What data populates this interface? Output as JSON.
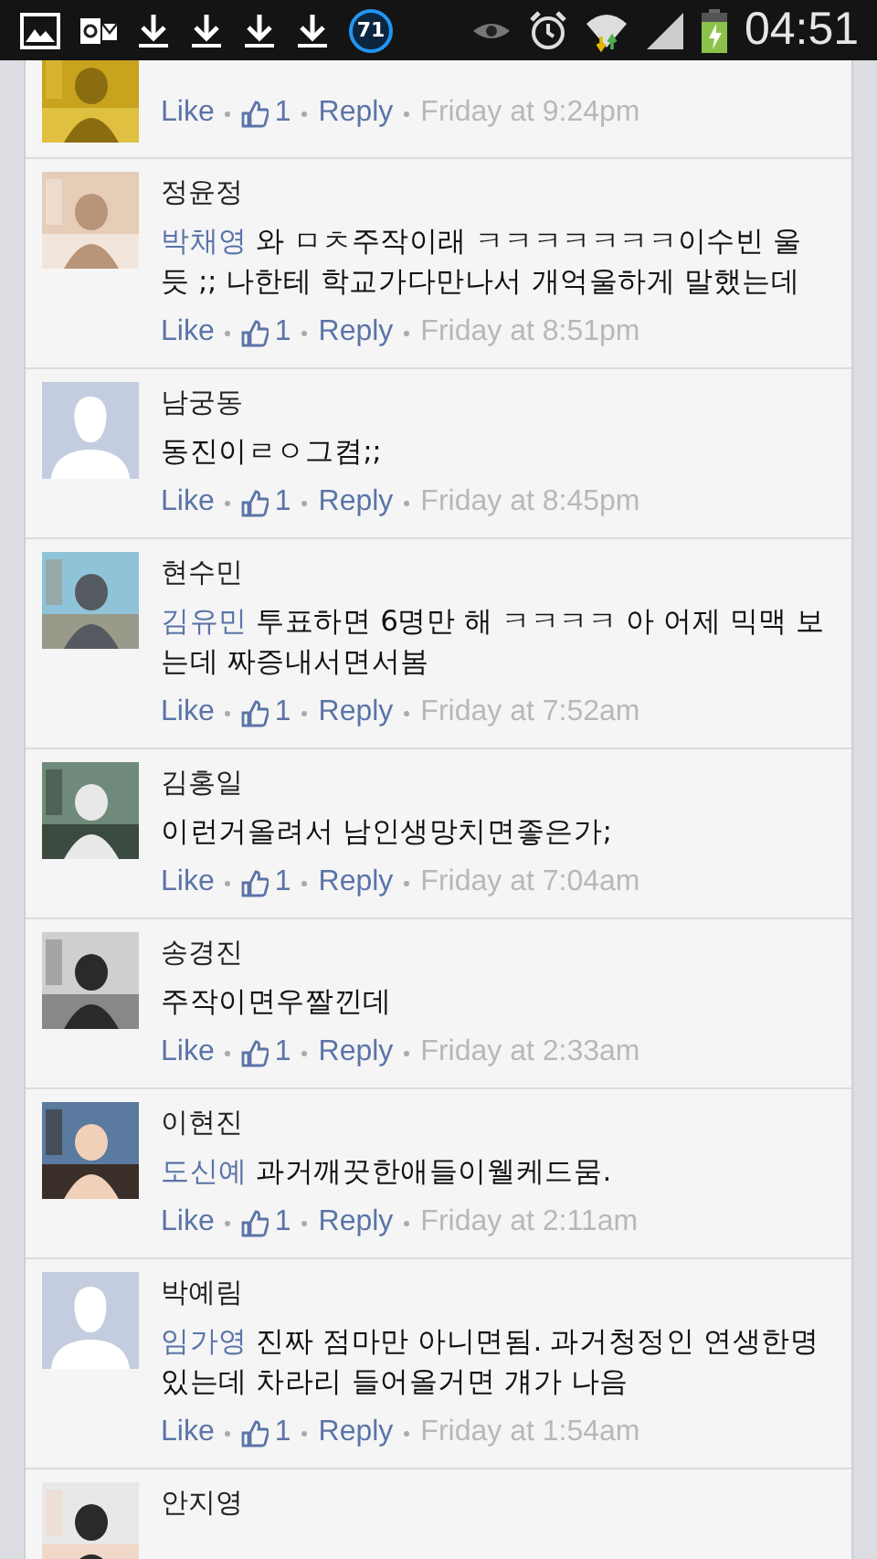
{
  "status_bar": {
    "badge": "71",
    "time": "04:51"
  },
  "comments": [
    {
      "kind": "cut",
      "like": "Like",
      "likes": "1",
      "reply": "Reply",
      "time": "Friday at 9:24pm"
    },
    {
      "kind": "full",
      "name": "정윤정",
      "mention": "박채영",
      "text": "와 ㅁㅊ주작이래 ㅋㅋㅋㅋㅋㅋㅋ이수빈 울듯 ;; 나한테 학교가다만나서 개억울하게 말했는데",
      "like": "Like",
      "likes": "1",
      "reply": "Reply",
      "time": "Friday at 8:51pm"
    },
    {
      "kind": "full",
      "avatar": {
        "kind": "silhouette"
      },
      "name": "남궁동",
      "text": "동진이ㄹㅇ그켬;;",
      "like": "Like",
      "likes": "1",
      "reply": "Reply",
      "time": "Friday at 8:45pm"
    },
    {
      "kind": "full",
      "name": "현수민",
      "mention": "김유민",
      "text": "투표하면 6명만 해 ㅋㅋㅋㅋ 아 어제 믹맥 보는데 짜증내서면서봄",
      "like": "Like",
      "likes": "1",
      "reply": "Reply",
      "time": "Friday at 7:52am"
    },
    {
      "kind": "full",
      "name": "김홍일",
      "text": "이런거올려서 남인생망치면좋은가;",
      "like": "Like",
      "likes": "1",
      "reply": "Reply",
      "time": "Friday at 7:04am"
    },
    {
      "kind": "full",
      "name": "송경진",
      "text": "주작이면우짤낀데",
      "like": "Like",
      "likes": "1",
      "reply": "Reply",
      "time": "Friday at 2:33am"
    },
    {
      "kind": "full",
      "name": "이현진",
      "mention": "도신예",
      "text": "과거깨끗한애들이웰케드뭄.",
      "like": "Like",
      "likes": "1",
      "reply": "Reply",
      "time": "Friday at 2:11am"
    },
    {
      "kind": "full",
      "avatar": {
        "kind": "silhouette"
      },
      "name": "박예림",
      "mention": "임가영",
      "text": "진짜 점마만 아니면됨. 과거청정인 연생한명있는데 차라리 들어올거면 걔가 나음",
      "like": "Like",
      "likes": "1",
      "reply": "Reply",
      "time": "Friday at 1:54am"
    },
    {
      "kind": "full",
      "name": "안지영"
    }
  ]
}
